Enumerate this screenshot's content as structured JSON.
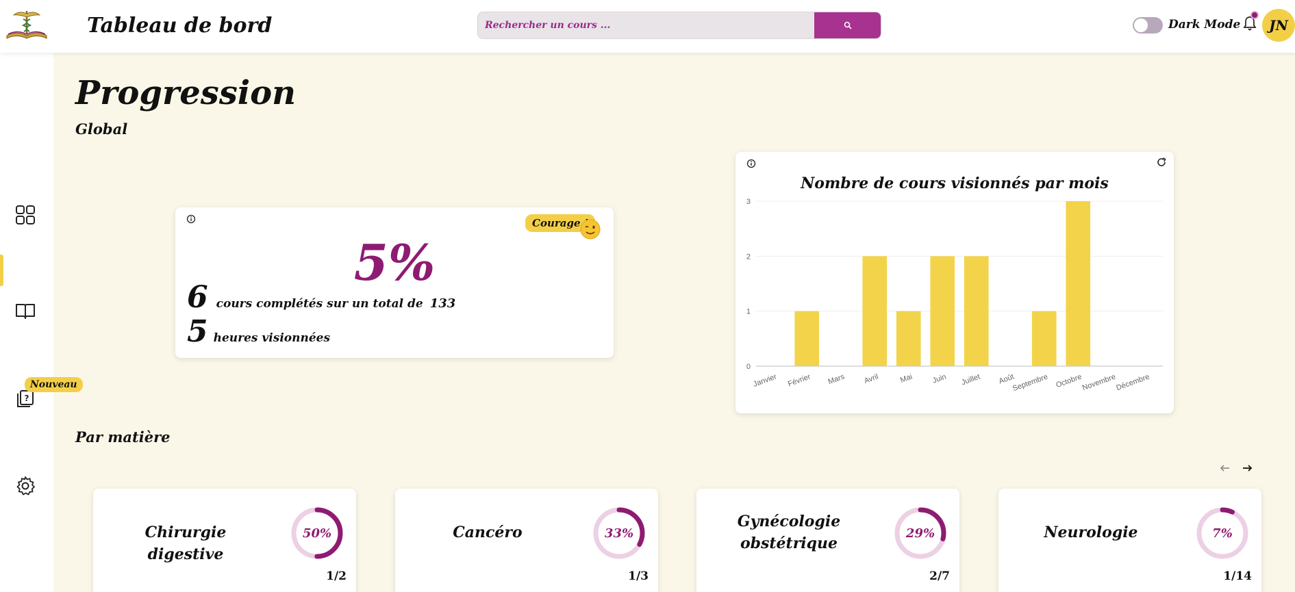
{
  "header": {
    "title": "Tableau de bord",
    "search_placeholder": "Rechercher un cours ...",
    "dark_mode_label": "Dark Mode",
    "avatar_initials": "JN"
  },
  "sidebar": {
    "items": [
      {
        "icon": "dashboard-grid-icon",
        "active": true
      },
      {
        "icon": "book-open-icon",
        "active": false
      },
      {
        "icon": "quiz-icon",
        "active": false,
        "badge": "Nouveau"
      },
      {
        "icon": "gear-icon",
        "active": false
      }
    ]
  },
  "main": {
    "title": "Progression",
    "global_label": "Global",
    "by_subject_label": "Par matière"
  },
  "global_card": {
    "badge": "Courage !",
    "percent": "5%",
    "completed_count": "6",
    "completed_text": "cours complétés sur un total de",
    "total": "133",
    "hours": "5",
    "hours_text": "heures visionnées"
  },
  "chart_data": {
    "type": "bar",
    "title": "Nombre de cours visionnés par mois",
    "categories": [
      "Janvier",
      "Février",
      "Mars",
      "Avril",
      "Mai",
      "Juin",
      "Juillet",
      "Août",
      "Septembre",
      "Octobre",
      "Novembre",
      "Décembre"
    ],
    "values": [
      0,
      1,
      0,
      2,
      1,
      2,
      2,
      0,
      1,
      3,
      0,
      0
    ],
    "ylim": [
      0,
      3
    ],
    "yticks": [
      0,
      1,
      2,
      3
    ],
    "grid": true,
    "bar_color": "#f3d34a"
  },
  "subjects": [
    {
      "name": "Chirurgie digestive",
      "percent": 50,
      "percent_label": "50%",
      "count": "1/2"
    },
    {
      "name": "Cancéro",
      "percent": 33,
      "percent_label": "33%",
      "count": "1/3"
    },
    {
      "name": "Gynécologie obstétrique",
      "percent": 29,
      "percent_label": "29%",
      "count": "2/7"
    },
    {
      "name": "Neurologie",
      "percent": 7,
      "percent_label": "7%",
      "count": "1/14"
    }
  ],
  "colors": {
    "accent": "#8e1b72",
    "yellow": "#f3cf48",
    "background": "#fbf7e8",
    "search_button": "#a8328f"
  }
}
